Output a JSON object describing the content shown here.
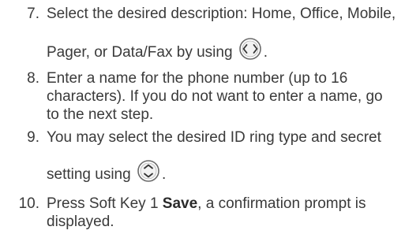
{
  "steps": [
    {
      "number": "7.",
      "line1": "Select the desired description: Home, Office, Mobile,",
      "line2_text": "Pager, or Data/Fax by using",
      "line2_suffix": ".",
      "icon": "left-right-navigation-key-icon"
    },
    {
      "number": "8.",
      "line1": "Enter a name for the phone number (up to 16",
      "line2": "characters). If you do not want to enter a name, go",
      "line3": "to the next step."
    },
    {
      "number": "9.",
      "line1": "You may select the desired ID ring type and secret",
      "line2_text": "setting using",
      "line2_suffix": ".",
      "icon": "up-down-navigation-key-icon"
    },
    {
      "number": "10.",
      "line1_prefix": "Press Soft Key 1",
      "line1_bold": "Save",
      "line1_suffix": ", a confirmation prompt is",
      "line2": "displayed."
    }
  ]
}
